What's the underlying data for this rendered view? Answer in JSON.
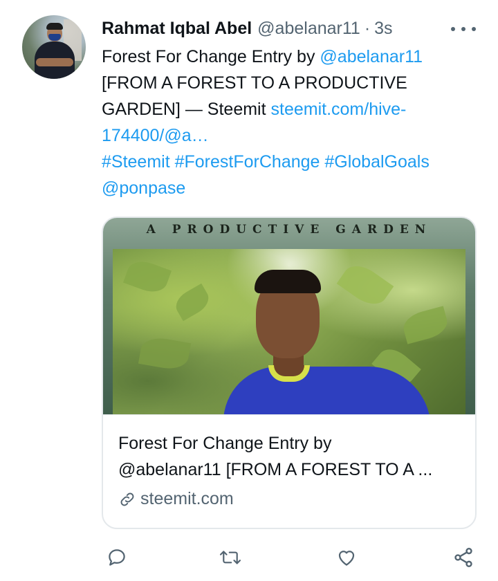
{
  "tweet": {
    "author_name": "Rahmat Iqbal Abel",
    "handle": "@abelanar11",
    "separator": "·",
    "time": "3s",
    "text": {
      "line1_text": "Forest For Change Entry by ",
      "line1_mention": "@abelanar11",
      "line2": "[FROM A FOREST TO A PRODUCTIVE",
      "line3_text": "GARDEN] — Steemit ",
      "line3_link": "steemit.com/hive-",
      "line4_link": "174400/@a…",
      "hashtags": "#Steemit #ForestForChange #GlobalGoals",
      "mention": "@ponpase"
    }
  },
  "card": {
    "banner_text": "A PRODUCTIVE GARDEN",
    "title_line1": "Forest For Change Entry by",
    "title_line2": "@abelanar11 [FROM A FOREST TO A ...",
    "domain": "steemit.com"
  },
  "icons": {
    "more": "more-icon",
    "reply": "reply-icon",
    "retweet": "retweet-icon",
    "like": "like-icon",
    "share": "share-icon",
    "link": "link-icon"
  },
  "colors": {
    "link": "#1d9bf0",
    "secondary_text": "#536471",
    "primary_text": "#0f1419",
    "border": "#e4e8eb"
  }
}
